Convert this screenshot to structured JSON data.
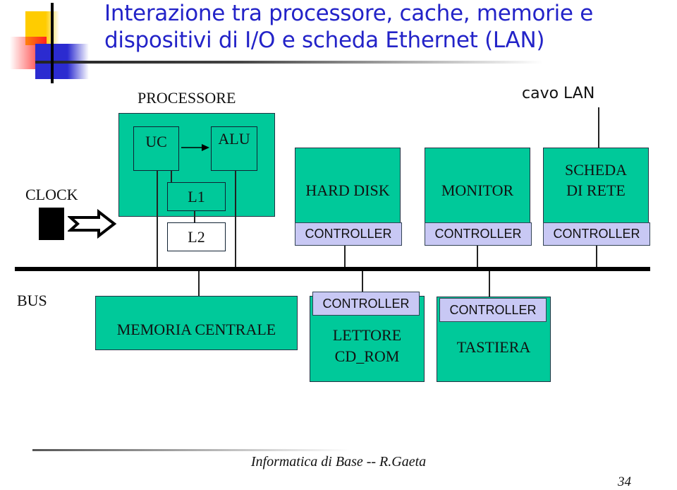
{
  "title": {
    "line1": "Interazione tra processore, cache, memorie e",
    "line2": "dispositivi di I/O e scheda Ethernet (LAN)"
  },
  "labels": {
    "processore": "PROCESSORE",
    "clock": "CLOCK",
    "bus": "BUS",
    "cavo_lan": "cavo LAN"
  },
  "processor": {
    "uc": "UC",
    "alu": "ALU",
    "l1": "L1",
    "l2": "L2"
  },
  "devices_top": [
    {
      "name": "HARD DISK",
      "controller": "CONTROLLER"
    },
    {
      "name": "MONITOR",
      "controller": "CONTROLLER"
    },
    {
      "name_line1": "SCHEDA",
      "name_line2": "DI RETE",
      "controller": "CONTROLLER"
    }
  ],
  "devices_bottom": [
    {
      "name": "MEMORIA CENTRALE"
    },
    {
      "name_line1": "LETTORE",
      "name_line2": "CD_ROM",
      "controller": "CONTROLLER"
    },
    {
      "name": "TASTIERA",
      "controller": "CONTROLLER"
    }
  ],
  "footer": {
    "text": "Informatica di Base -- R.Gaeta",
    "page_number": "34"
  },
  "colors": {
    "title": "#2323c8",
    "device_fill": "#00c99a",
    "controller_fill": "#c8c8f4"
  }
}
